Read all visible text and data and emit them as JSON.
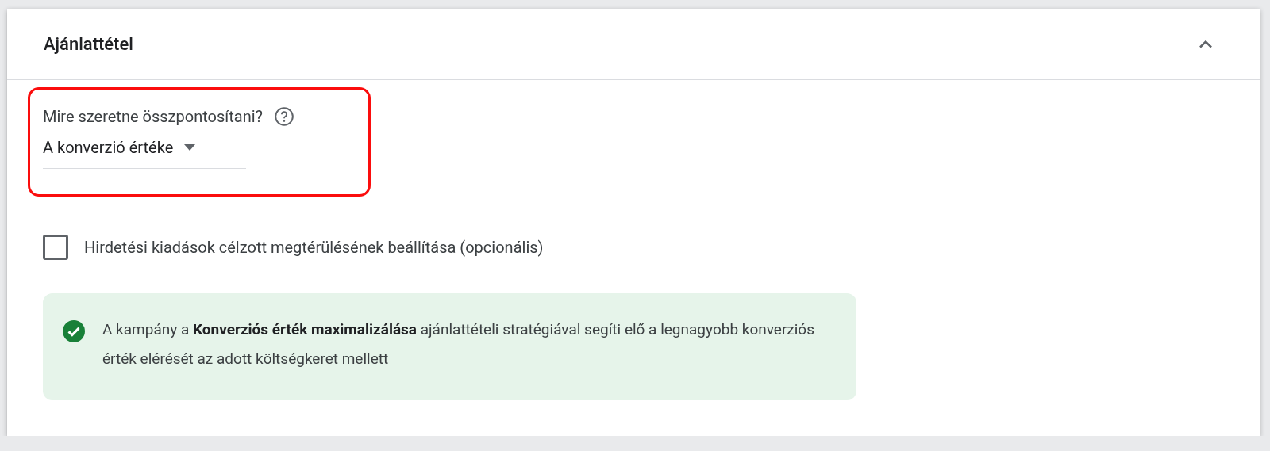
{
  "panel": {
    "title": "Ajánlattétel",
    "expanded": true
  },
  "focus": {
    "label": "Mire szeretne összpontosítani?",
    "value": "A konverzió értéke",
    "highlighted": true
  },
  "roas_checkbox": {
    "label": "Hirdetési kiadások célzott megtérülésének beállítása (opcionális)",
    "checked": false
  },
  "notice": {
    "kind": "success",
    "text": "A kampány a **Konverziós érték maximalizálása** ajánlattételi stratégiával segíti elő a legnagyobb konverziós érték elérését az adott költségkeret mellett"
  }
}
